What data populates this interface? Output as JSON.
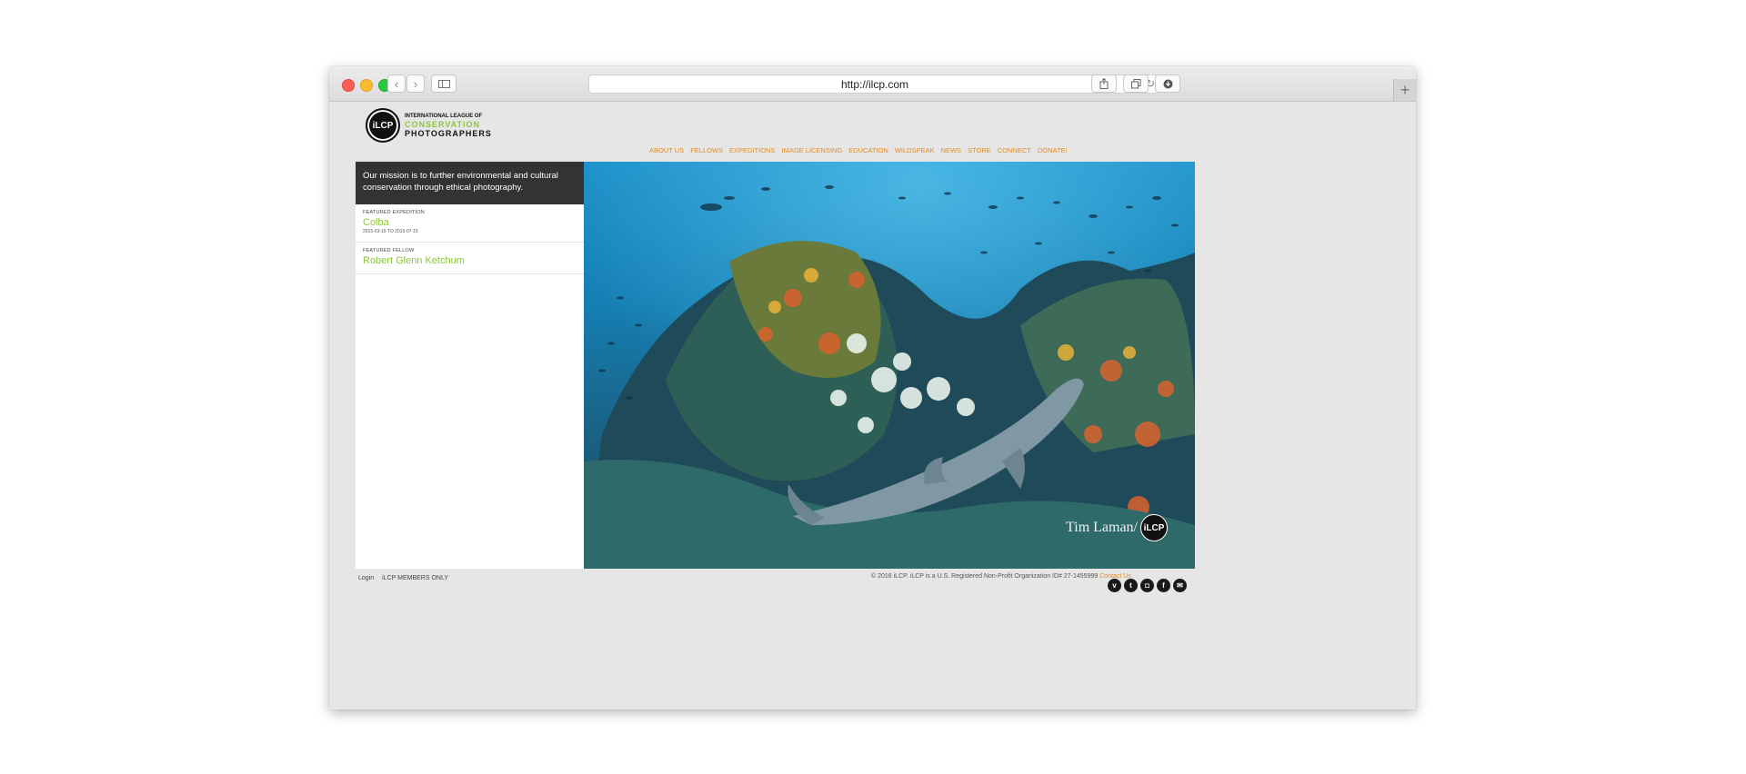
{
  "browser": {
    "url": "http://ilcp.com",
    "reload_icon": "reload-icon",
    "back_icon": "chevron-left-icon",
    "forward_icon": "chevron-right-icon"
  },
  "site": {
    "logo_badge": "iLCP",
    "logo_line1": "INTERNATIONAL LEAGUE OF",
    "logo_line2": "CONSERVATION",
    "logo_line3": "PHOTOGRAPHERS",
    "nav": [
      "ABOUT US",
      "FELLOWS",
      "EXPEDITIONS",
      "IMAGE LICENSING",
      "EDUCATION",
      "WILDSPEAK",
      "NEWS",
      "STORE",
      "CONNECT",
      "DONATE!"
    ],
    "mission": "Our mission is to further environmental and cultural conservation through ethical photography.",
    "featured_expedition": {
      "label": "FEATURED EXPEDITION",
      "name": "Colba",
      "dates": "2015-03-15 TO 2015-07-15"
    },
    "featured_fellow": {
      "label": "FEATURED FELLOW",
      "name": "Robert Glenn Ketchum"
    },
    "hero_credit": "Tim Laman/",
    "hero_badge": "iLCP",
    "footer": {
      "login": "Login",
      "members": "iLCP MEMBERS ONLY",
      "copyright": "© 2016 iLCP. iLCP is a U.S. Registered Non-Profit Organization ID# 27-1455999",
      "contact": "Contact Us"
    },
    "social": [
      {
        "icon": "vimeo-icon",
        "glyph": "v"
      },
      {
        "icon": "twitter-icon",
        "glyph": "t"
      },
      {
        "icon": "instagram-icon",
        "glyph": "◘"
      },
      {
        "icon": "facebook-icon",
        "glyph": "f"
      },
      {
        "icon": "mail-icon",
        "glyph": "✉"
      }
    ]
  },
  "colors": {
    "accent_green": "#8cc63f",
    "nav_orange": "#e48a1e",
    "mission_bg": "#333333"
  }
}
